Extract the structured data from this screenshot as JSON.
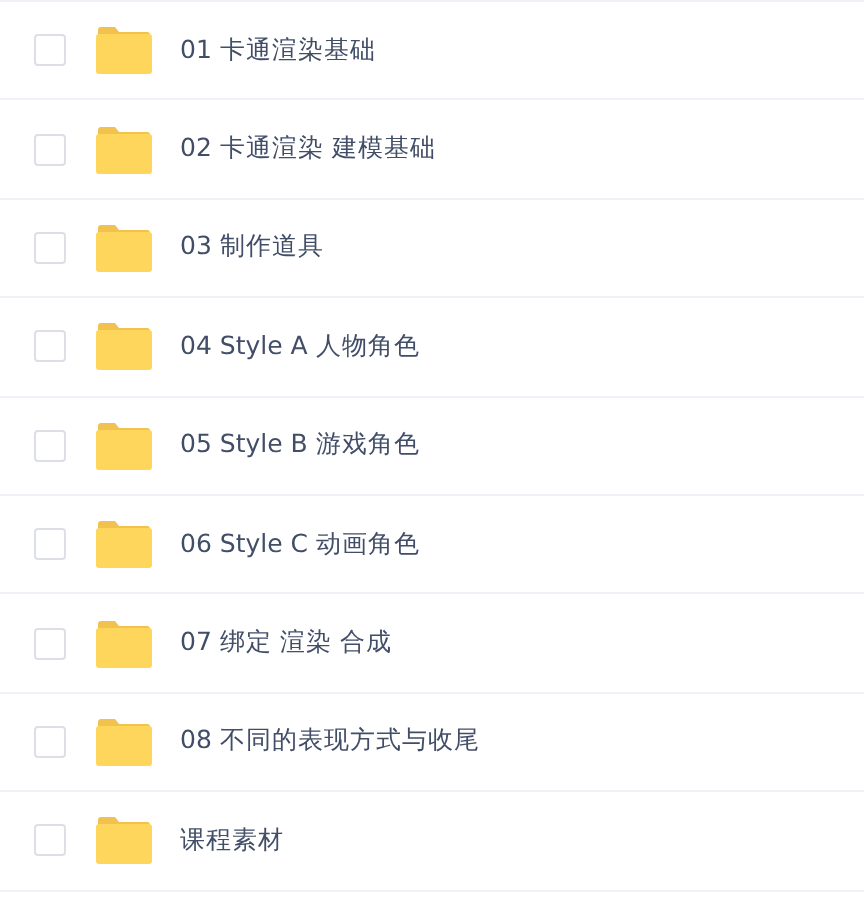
{
  "folders": [
    {
      "name": "01 卡通渲染基础",
      "checked": false
    },
    {
      "name": "02 卡通渲染 建模基础",
      "checked": false
    },
    {
      "name": "03 制作道具",
      "checked": false
    },
    {
      "name": "04 Style A 人物角色",
      "checked": false
    },
    {
      "name": "05 Style B 游戏角色",
      "checked": false
    },
    {
      "name": "06 Style C 动画角色",
      "checked": false
    },
    {
      "name": "07 绑定 渲染 合成",
      "checked": false
    },
    {
      "name": "08 不同的表现方式与收尾",
      "checked": false
    },
    {
      "name": "课程素材",
      "checked": false
    }
  ]
}
